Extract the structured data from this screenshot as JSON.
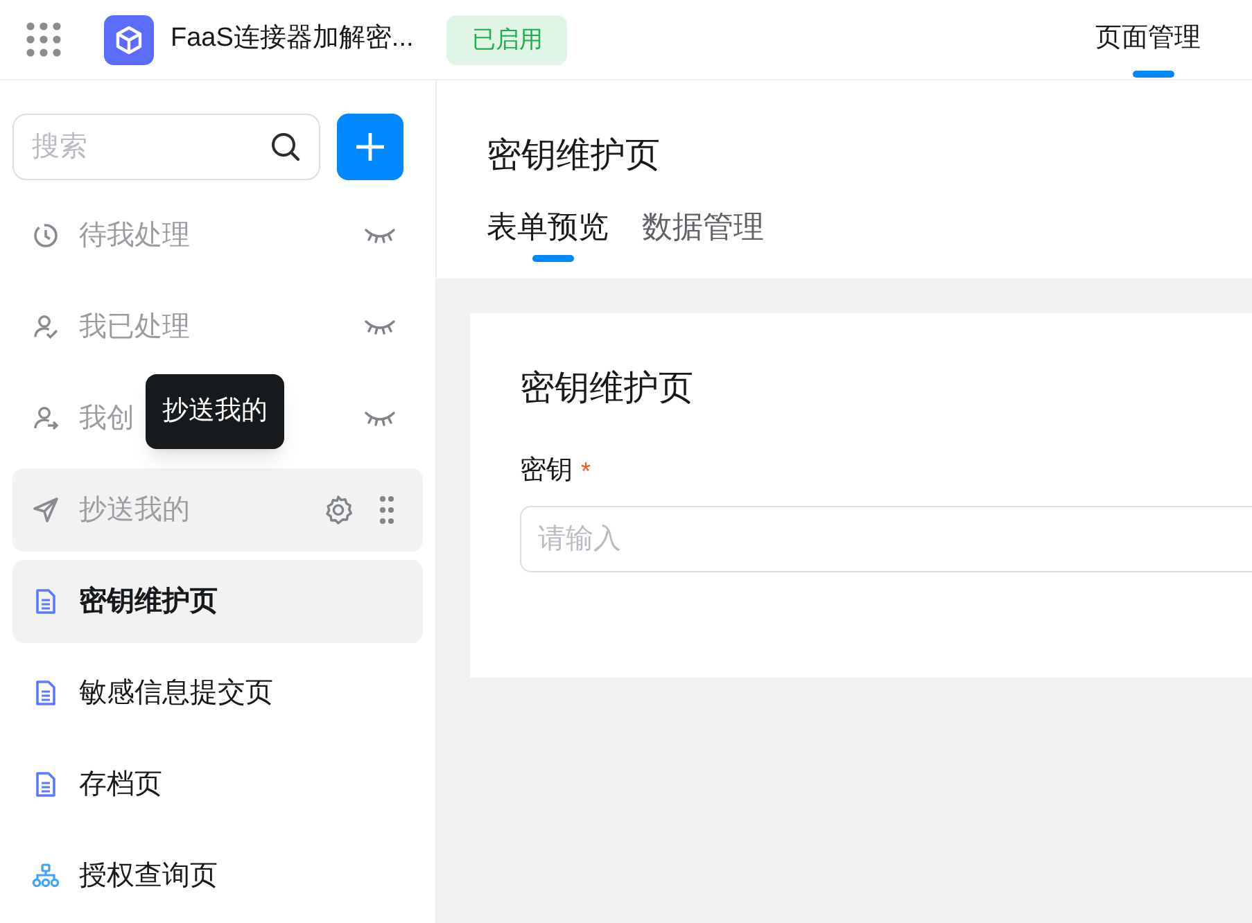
{
  "header": {
    "app_title": "FaaS连接器加解密...",
    "status_badge": "已启用",
    "nav_tabs": [
      {
        "label": "页面管理",
        "selected": true
      }
    ]
  },
  "sidebar": {
    "search": {
      "placeholder": "搜索"
    },
    "items": [
      {
        "label": "待我处理",
        "kind": "clock",
        "hidden": true,
        "hovered": false,
        "selected": false
      },
      {
        "label": "我已处理",
        "kind": "user-check",
        "hidden": true,
        "hovered": false,
        "selected": false
      },
      {
        "label": "我创",
        "kind": "user-send",
        "hidden": true,
        "hovered": false,
        "selected": false
      },
      {
        "label": "抄送我的",
        "kind": "send",
        "hidden": false,
        "hovered": true,
        "selected": false
      },
      {
        "label": "密钥维护页",
        "kind": "doc",
        "hidden": false,
        "hovered": false,
        "selected": true
      },
      {
        "label": "敏感信息提交页",
        "kind": "doc",
        "hidden": false,
        "hovered": false,
        "selected": false
      },
      {
        "label": "存档页",
        "kind": "doc",
        "hidden": false,
        "hovered": false,
        "selected": false
      },
      {
        "label": "授权查询页",
        "kind": "org",
        "hidden": false,
        "hovered": false,
        "selected": false
      }
    ],
    "tooltip": "抄送我的"
  },
  "page": {
    "title": "密钥维护页",
    "tabs": [
      {
        "label": "表单预览",
        "selected": true
      },
      {
        "label": "数据管理",
        "selected": false
      }
    ],
    "form": {
      "title": "密钥维护页",
      "fields": [
        {
          "label": "密钥",
          "required": true,
          "required_mark": "*",
          "placeholder": "请输入"
        }
      ]
    }
  }
}
